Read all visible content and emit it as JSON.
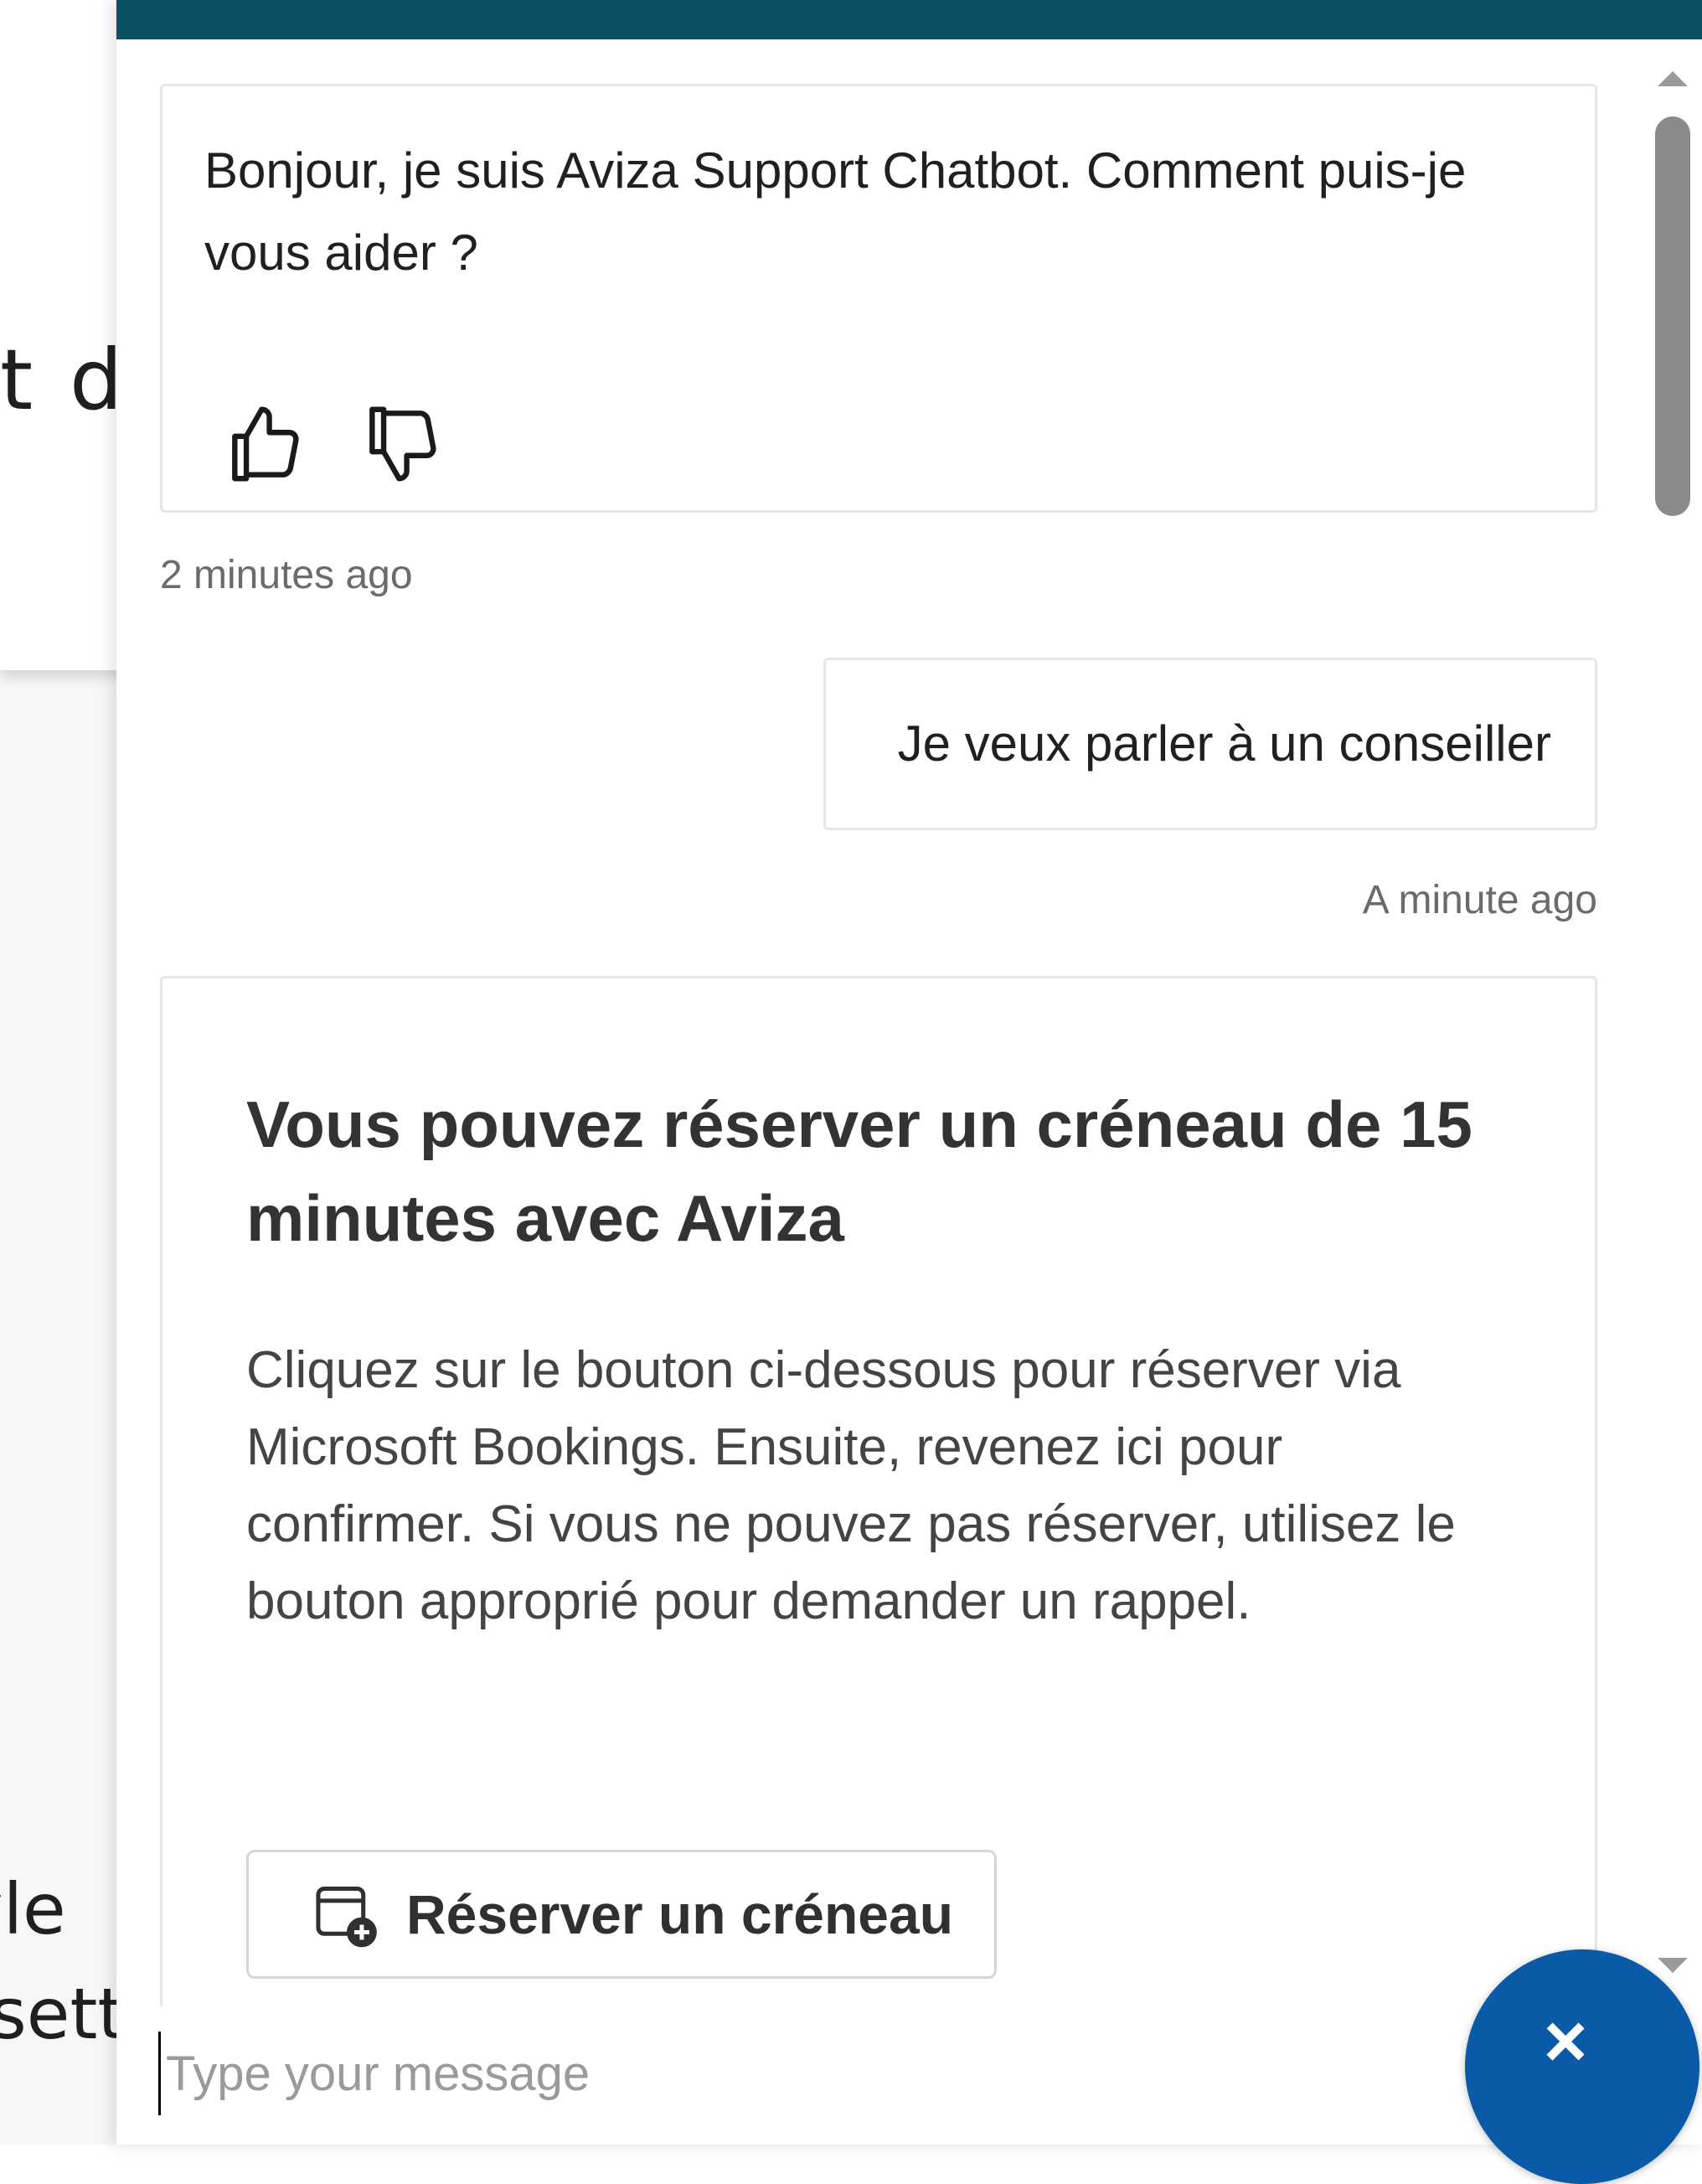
{
  "background": {
    "line1": "t d",
    "line2": "yle",
    "line3": "sett"
  },
  "chat": {
    "messages": [
      {
        "from": "bot",
        "text": "Bonjour, je suis Aviza Support Chatbot. Comment puis-je vous aider ?",
        "timestamp": "2 minutes ago"
      },
      {
        "from": "user",
        "text": "Je veux parler à un conseiller",
        "timestamp": "A minute ago"
      }
    ],
    "card": {
      "title": "Vous pouvez réserver un créneau de 15 minutes avec Aviza",
      "body": "Cliquez sur le bouton ci-dessous pour réserver via Microsoft Bookings. Ensuite, revenez ici pour confirmer. Si vous ne pouvez pas réserver, utilisez le bouton approprié pour demander un rappel.",
      "book_button": "Réserver un créneau"
    },
    "input": {
      "placeholder": "Type your message",
      "value": ""
    },
    "close_label": "×"
  },
  "colors": {
    "brand_teal": "#0a4f63",
    "alert_red": "#c8102e",
    "close_blue": "#0a5aa8"
  },
  "icons": {
    "like": "thumbs-up-icon",
    "dislike": "thumbs-down-icon",
    "calendar": "calendar-add-icon",
    "close": "close-icon"
  }
}
